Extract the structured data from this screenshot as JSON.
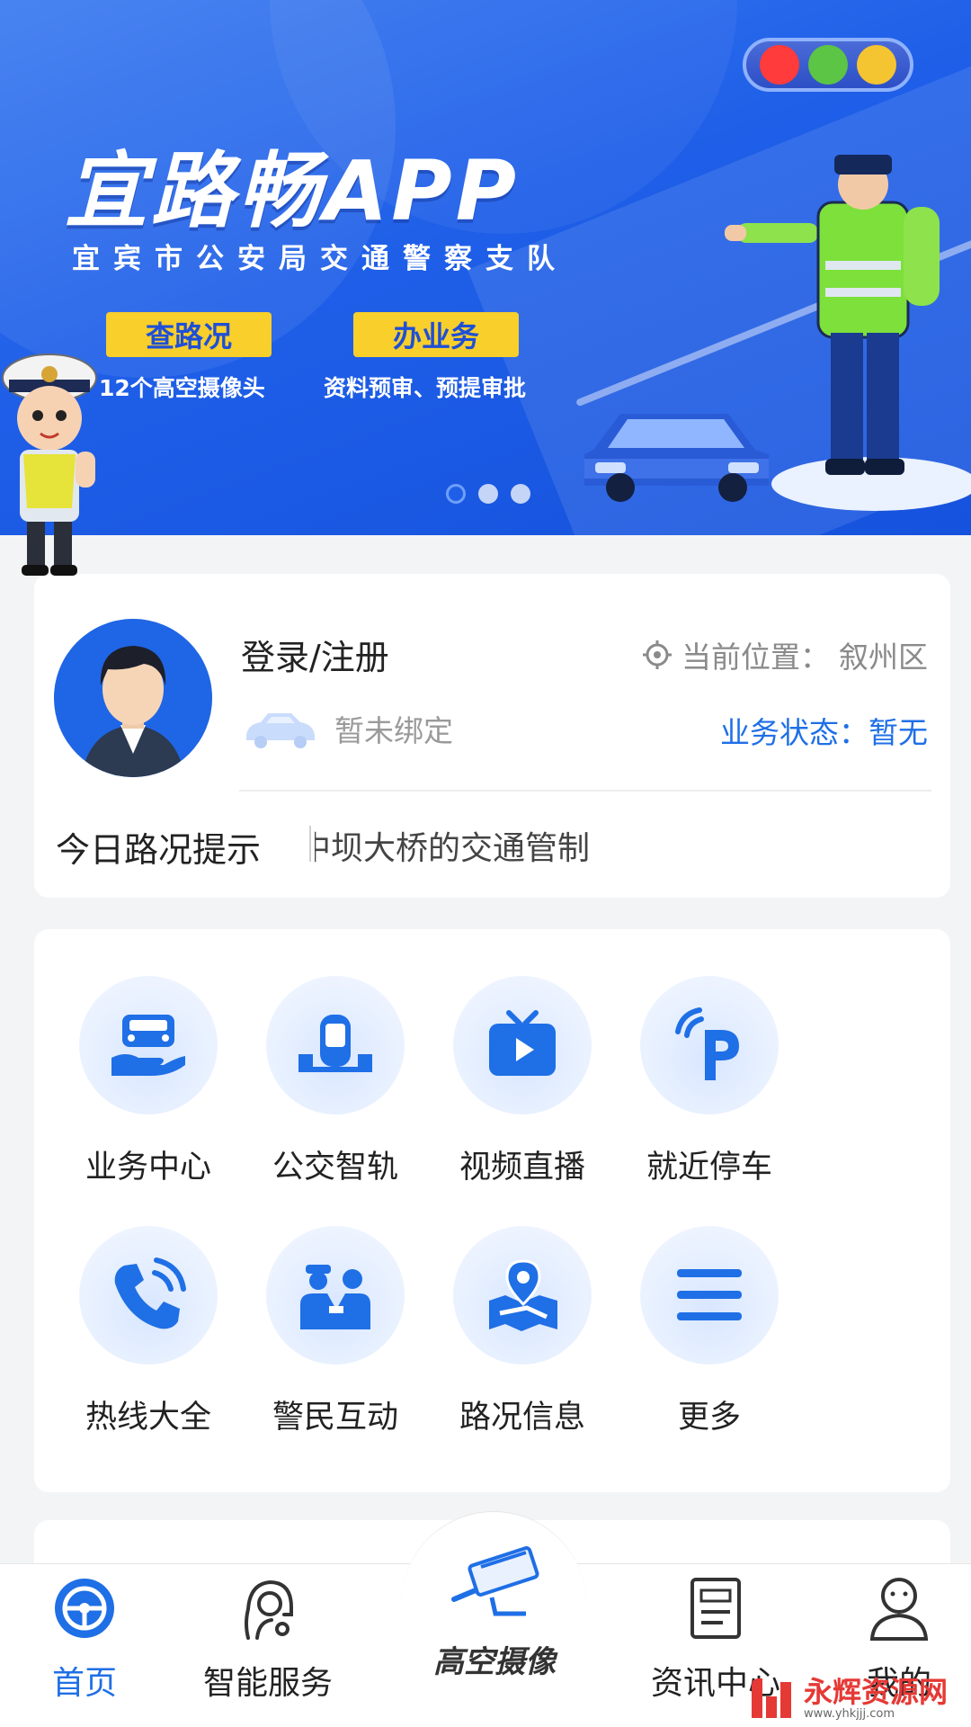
{
  "banner": {
    "title": "宜路畅APP",
    "subtitle": "宜宾市公安局交通警察支队",
    "pill1": "查路况",
    "pill1_caption": "12个高空摄像头",
    "pill2": "办业务",
    "pill2_caption": "资料预审、预提审批",
    "carousel_active_index": 0,
    "carousel_count": 3,
    "traffic_light_colors": [
      "#ff3b3b",
      "#5cc545",
      "#f5c431"
    ]
  },
  "user": {
    "login_label": "登录/注册",
    "location_label": "当前位置：",
    "location_value": "叙州区",
    "vehicle_status": "暂未绑定",
    "business_status_label": "业务状态：",
    "business_status_value": "暂无",
    "tips_label": "今日路况提示",
    "tips_text": "中坝大桥的交通管制"
  },
  "services": [
    {
      "label": "业务中心",
      "icon": "car-hand-icon"
    },
    {
      "label": "公交智轨",
      "icon": "tram-icon"
    },
    {
      "label": "视频直播",
      "icon": "tv-play-icon"
    },
    {
      "label": "就近停车",
      "icon": "parking-icon"
    },
    {
      "label": "热线大全",
      "icon": "phone-icon"
    },
    {
      "label": "警民互动",
      "icon": "police-people-icon"
    },
    {
      "label": "路况信息",
      "icon": "map-pin-icon"
    },
    {
      "label": "更多",
      "icon": "menu-icon"
    }
  ],
  "nav": {
    "home": "首页",
    "service": "智能服务",
    "camera": "高空摄像",
    "news": "资讯中心",
    "mine": "我的"
  },
  "watermark": {
    "title": "永辉资源网",
    "url": "www.yhkjjj.com"
  },
  "colors": {
    "primary": "#1f6fe6",
    "banner_blue": "#1f5fe8",
    "pill_yellow": "#f8cf2b"
  }
}
